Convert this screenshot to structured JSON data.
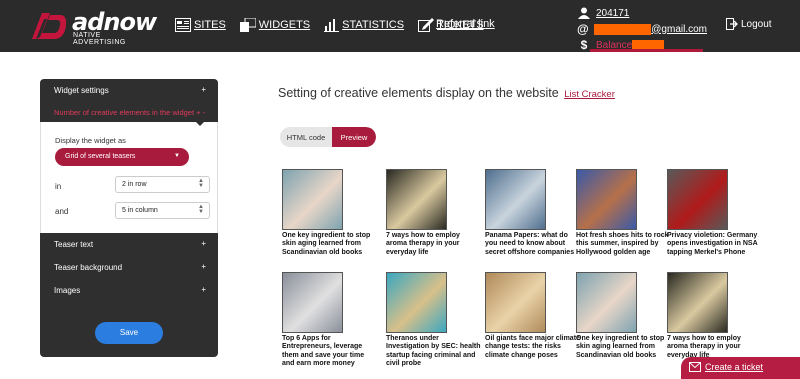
{
  "brand": {
    "name": "adnow",
    "tagline": "NATIVE ADVERTISING",
    "color_accent": "#a81b3c"
  },
  "nav": {
    "items": [
      {
        "label": "SITES",
        "icon": "sites-icon"
      },
      {
        "label": "WIDGETS",
        "icon": "widgets-icon"
      },
      {
        "label": "STATISTICS",
        "icon": "statistics-icon"
      },
      {
        "label": "TICKETS",
        "icon": "tickets-icon"
      }
    ],
    "referral": "Referral link"
  },
  "account": {
    "id": "204171",
    "email_suffix": "@gmail.com",
    "balance_label": "Balance",
    "logout": "Logout"
  },
  "sidebar": {
    "widget_settings": "Widget settings",
    "creative_count": "Number of creative elements in the widget",
    "display_as_label": "Display the widget as",
    "display_as_value": "Grid of several teasers",
    "in_label": "in",
    "in_value": "2 in row",
    "and_label": "and",
    "and_value": "5 in column",
    "sections": [
      "Teaser text",
      "Teaser background",
      "Images"
    ],
    "save": "Save"
  },
  "main": {
    "title": "Setting of creative elements display on the website",
    "site_link": "List Cracker",
    "tabs": {
      "html": "HTML code",
      "preview": "Preview"
    }
  },
  "teasers": [
    {
      "text": "One key ingredient to stop skin aging learned from Scandinavian old books",
      "palette": [
        "#7ea3b0",
        "#e8d6c8"
      ]
    },
    {
      "text": "7 ways how to employ aroma therapy in your everyday life",
      "palette": [
        "#2a2a22",
        "#d9c9a0"
      ]
    },
    {
      "text": "Panama Papers: what do you need to know about secret offshore companies",
      "palette": [
        "#4f6f8f",
        "#c9d4dd"
      ]
    },
    {
      "text": "Hot fresh shoes hits to rock this summer, inspired by Hollywood golden age",
      "palette": [
        "#3a5aa8",
        "#b7704a"
      ]
    },
    {
      "text": "Privacy violetion: Germany opens investigation in NSA tapping Merkel's Phone",
      "palette": [
        "#5a5a5a",
        "#b01a1a"
      ]
    },
    {
      "text": "Top 6 Apps for Entrepreneurs, leverage them and save your time and earn more money",
      "palette": [
        "#8a8f9a",
        "#e0e0e0"
      ]
    },
    {
      "text": "Theranos under Investigation by SEC: health startup facing criminal and civil probe",
      "palette": [
        "#3aa7c0",
        "#d8c08a"
      ]
    },
    {
      "text": "Oil giants face major climate change tests: the risks climate change poses",
      "palette": [
        "#b08a5a",
        "#e9d3a8"
      ]
    },
    {
      "text": "One key ingredient to stop skin aging learned from Scandinavian old books",
      "palette": [
        "#7ea3b0",
        "#e8d6c8"
      ]
    },
    {
      "text": "7 ways how to employ aroma therapy in your everyday life",
      "palette": [
        "#2a2a22",
        "#d9c9a0"
      ]
    }
  ],
  "ticket": {
    "label": "Create a ticket",
    "icon": "mail-icon"
  }
}
